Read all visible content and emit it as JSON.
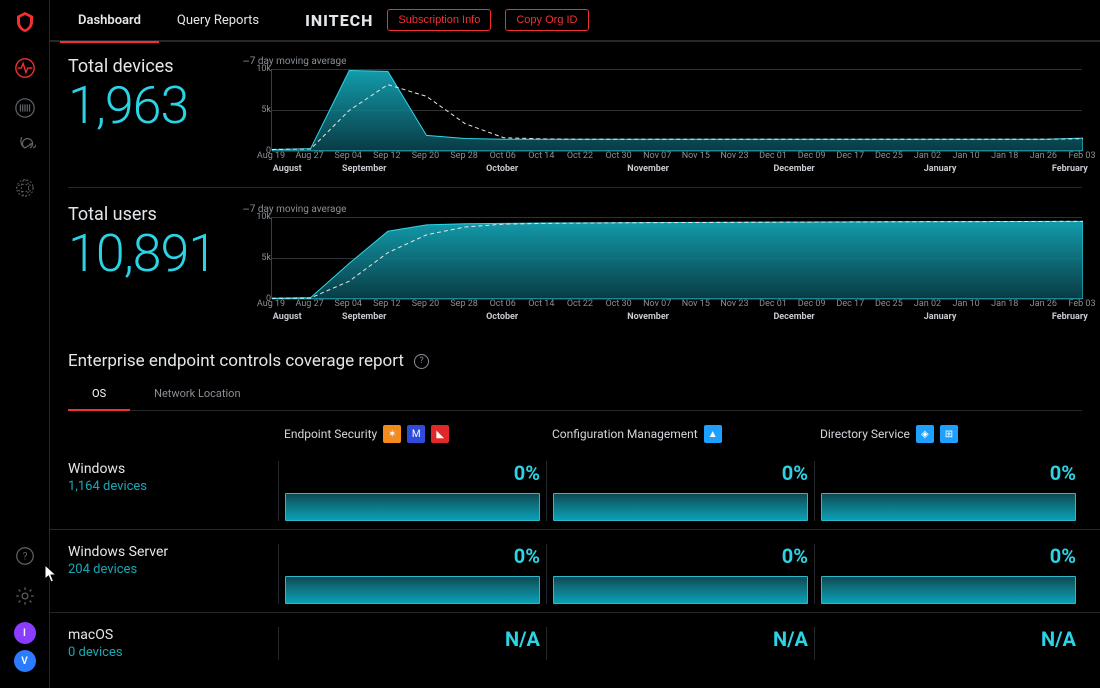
{
  "rail": {
    "avatars": [
      {
        "initial": "I",
        "bg": "#8a3cff"
      },
      {
        "initial": "V",
        "bg": "#2a7bff"
      }
    ]
  },
  "topbar": {
    "tabs": [
      {
        "label": "Dashboard",
        "active": true
      },
      {
        "label": "Query Reports",
        "active": false
      }
    ],
    "org": "INITECH",
    "subscription_btn": "Subscription Info",
    "copy_org_btn": "Copy Org ID"
  },
  "metrics": {
    "devices": {
      "label": "Total devices",
      "value": "1,963"
    },
    "users": {
      "label": "Total users",
      "value": "10,891"
    },
    "legend": "7 day moving average"
  },
  "chart_axis": {
    "y": [
      "10k",
      "5k",
      "0"
    ],
    "ticks": [
      "Aug 19",
      "Aug 27",
      "Sep 04",
      "Sep 12",
      "Sep 20",
      "Sep 28",
      "Oct 06",
      "Oct 14",
      "Oct 22",
      "Oct 30",
      "Nov 07",
      "Nov 15",
      "Nov 23",
      "Dec 01",
      "Dec 09",
      "Dec 17",
      "Dec 25",
      "Jan 02",
      "Jan 10",
      "Jan 18",
      "Jan 26",
      "Feb 03"
    ],
    "months": [
      {
        "label": "August",
        "pos": 0.02
      },
      {
        "label": "September",
        "pos": 0.115
      },
      {
        "label": "October",
        "pos": 0.285
      },
      {
        "label": "November",
        "pos": 0.465
      },
      {
        "label": "December",
        "pos": 0.645
      },
      {
        "label": "January",
        "pos": 0.825
      },
      {
        "label": "February",
        "pos": 0.985
      }
    ]
  },
  "chart_data": [
    {
      "type": "area",
      "title": "Total devices",
      "ylim": [
        0,
        10500
      ],
      "ylabel": "",
      "x": [
        "Aug 19",
        "Aug 27",
        "Sep 04",
        "Sep 12",
        "Sep 20",
        "Sep 28",
        "Oct 06",
        "Oct 14",
        "Oct 22",
        "Oct 30",
        "Nov 07",
        "Nov 15",
        "Nov 23",
        "Dec 01",
        "Dec 09",
        "Dec 17",
        "Dec 25",
        "Jan 02",
        "Jan 10",
        "Jan 18",
        "Jan 26",
        "Feb 03"
      ],
      "series": [
        {
          "name": "Total devices",
          "values": [
            200,
            300,
            10300,
            10200,
            2000,
            1600,
            1500,
            1500,
            1500,
            1500,
            1500,
            1500,
            1500,
            1500,
            1500,
            1500,
            1500,
            1500,
            1500,
            1500,
            1500,
            1650
          ]
        },
        {
          "name": "7 day moving average",
          "values": [
            200,
            250,
            5200,
            8500,
            7000,
            3500,
            1700,
            1550,
            1500,
            1500,
            1500,
            1500,
            1500,
            1500,
            1500,
            1500,
            1500,
            1500,
            1500,
            1500,
            1500,
            1580
          ]
        }
      ]
    },
    {
      "type": "area",
      "title": "Total users",
      "ylim": [
        0,
        11500
      ],
      "ylabel": "",
      "x": [
        "Aug 19",
        "Aug 27",
        "Sep 04",
        "Sep 12",
        "Sep 20",
        "Sep 28",
        "Oct 06",
        "Oct 14",
        "Oct 22",
        "Oct 30",
        "Nov 07",
        "Nov 15",
        "Nov 23",
        "Dec 01",
        "Dec 09",
        "Dec 17",
        "Dec 25",
        "Jan 02",
        "Jan 10",
        "Jan 18",
        "Jan 26",
        "Feb 03"
      ],
      "series": [
        {
          "name": "Total users",
          "values": [
            100,
            200,
            5000,
            9500,
            10400,
            10550,
            10600,
            10650,
            10680,
            10700,
            10720,
            10740,
            10760,
            10780,
            10800,
            10820,
            10840,
            10850,
            10860,
            10870,
            10880,
            10891
          ]
        },
        {
          "name": "7 day moving average",
          "values": [
            100,
            150,
            2500,
            6500,
            9000,
            10100,
            10500,
            10600,
            10650,
            10690,
            10710,
            10730,
            10750,
            10770,
            10790,
            10810,
            10830,
            10845,
            10855,
            10865,
            10875,
            10885
          ]
        }
      ]
    }
  ],
  "coverage": {
    "title": "Enterprise endpoint controls coverage report",
    "subtabs": [
      {
        "label": "OS",
        "active": true
      },
      {
        "label": "Network Location",
        "active": false
      }
    ],
    "categories": [
      {
        "label": "Endpoint Security",
        "icons": [
          {
            "bg": "#f38b1d",
            "glyph": "✶"
          },
          {
            "bg": "#2e4bd9",
            "glyph": "M"
          },
          {
            "bg": "#e02828",
            "glyph": "◣"
          }
        ]
      },
      {
        "label": "Configuration Management",
        "icons": [
          {
            "bg": "#1ea0ff",
            "glyph": "▲"
          }
        ]
      },
      {
        "label": "Directory Service",
        "icons": [
          {
            "bg": "#1ea0ff",
            "glyph": "◈"
          },
          {
            "bg": "#1ea0ff",
            "glyph": "⊞"
          }
        ]
      }
    ],
    "rows": [
      {
        "os": "Windows",
        "devices": "1,164 devices",
        "cells": [
          "0%",
          "0%",
          "0%"
        ],
        "bar": true
      },
      {
        "os": "Windows Server",
        "devices": "204 devices",
        "cells": [
          "0%",
          "0%",
          "0%"
        ],
        "bar": true
      },
      {
        "os": "macOS",
        "devices": "0 devices",
        "cells": [
          "N/A",
          "N/A",
          "N/A"
        ],
        "bar": false
      }
    ]
  }
}
